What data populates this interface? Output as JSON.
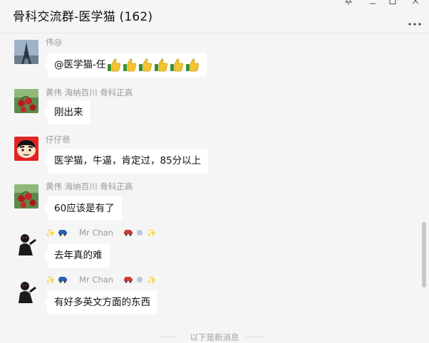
{
  "window": {
    "title": "骨科交流群-医学猫 (162)"
  },
  "messages": [
    {
      "sender": "伟@",
      "text": "@医学猫-任",
      "thumbs": 6,
      "avatar": "eiffel-tower-avatar"
    },
    {
      "sender": "黄伟  海纳百川  骨科正高",
      "text": "刚出来",
      "avatar": "cherry-tomato-avatar"
    },
    {
      "sender": "仔仔爸",
      "text": "医学猫，牛逼，肯定过，85分以上",
      "avatar": "cartoon-boy-avatar"
    },
    {
      "sender": "黄伟  海纳百川  骨科正高",
      "text": "60应该是有了",
      "avatar": "cherry-tomato-avatar"
    },
    {
      "sender_name": "Mr Chan",
      "text": "去年真的难",
      "avatar": "dark-figure-avatar"
    },
    {
      "sender_name": "Mr Chan",
      "text": "有好多英文方面的东西",
      "avatar": "dark-figure-avatar"
    }
  ],
  "divider": {
    "label": "以下是新消息"
  },
  "colors": {
    "background": "#f5f5f5",
    "bubble": "#ffffff",
    "sender": "#999999"
  }
}
